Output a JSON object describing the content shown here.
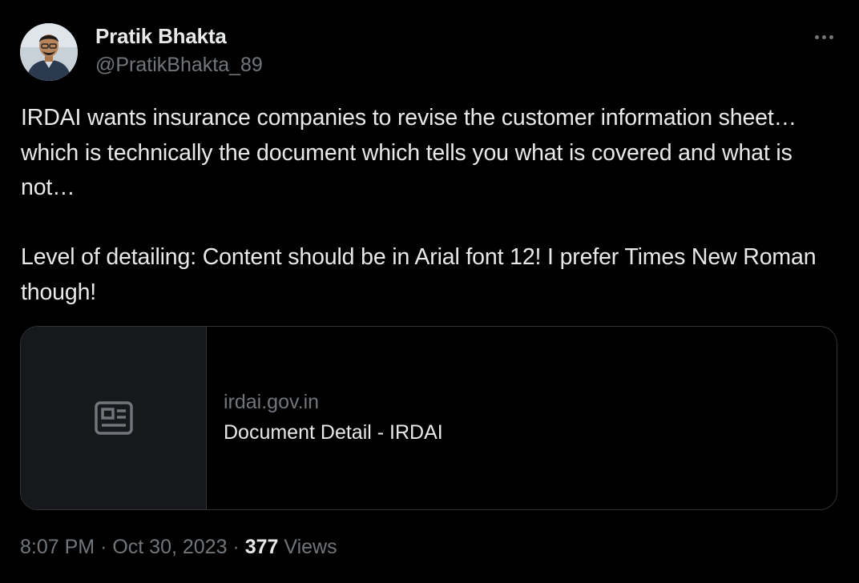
{
  "author": {
    "display_name": "Pratik Bhakta",
    "handle": "@PratikBhakta_89"
  },
  "tweet": {
    "text": "IRDAI wants insurance companies to revise the customer information sheet…which is technically the document which tells you what is covered and what is not…\n\nLevel of detailing: Content should be in Arial font 12! I prefer Times New Roman though!"
  },
  "card": {
    "domain": "irdai.gov.in",
    "title": "Document Detail - IRDAI",
    "thumbnail_icon": "news-article-icon"
  },
  "meta": {
    "time": "8:07 PM",
    "separator1": " · ",
    "date": "Oct 30, 2023",
    "separator2": " · ",
    "views_count": "377",
    "views_label": " Views"
  },
  "icons": {
    "more": "more-options-icon"
  },
  "colors": {
    "background": "#000000",
    "primary_text": "#e7e9ea",
    "secondary_text": "#71767b",
    "border": "#2f3336",
    "card_thumb_bg": "#16181c"
  }
}
